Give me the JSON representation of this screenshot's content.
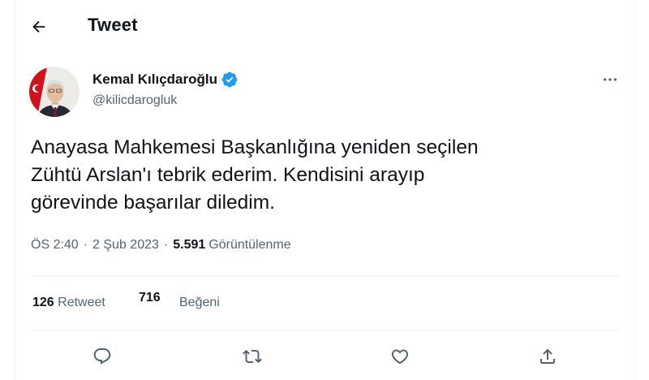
{
  "header": {
    "title": "Tweet",
    "back_icon": "arrow-left-icon"
  },
  "author": {
    "name": "Kemal Kılıçdaroğlu",
    "handle": "@kilicdarogluk",
    "verified": true,
    "verified_color": "#1d9bf0",
    "avatar": "avatar-photo"
  },
  "more_icon": "more-horizontal-icon",
  "tweet": {
    "text": "Anayasa Mahkemesi Başkanlığına yeniden seçilen\nZühtü Arslan'ı tebrik ederim. Kendisini arayıp\ngörevinde başarılar diledim.",
    "time": "ÖS 2:40",
    "separator": "·",
    "date": "2 Şub 2023",
    "views_count": "5.591",
    "views_label": "Görüntülenme"
  },
  "stats": {
    "retweets_count": "126",
    "retweets_label": "Retweet",
    "likes_count": "716",
    "likes_label": "Beğeni"
  },
  "actions": [
    {
      "name": "reply",
      "icon": "reply-icon"
    },
    {
      "name": "retweet",
      "icon": "retweet-icon"
    },
    {
      "name": "like",
      "icon": "heart-icon"
    },
    {
      "name": "share",
      "icon": "share-icon"
    }
  ],
  "colors": {
    "text": "#0f1419",
    "secondary": "#536471",
    "divider": "#eff3f4",
    "accent": "#1d9bf0"
  }
}
